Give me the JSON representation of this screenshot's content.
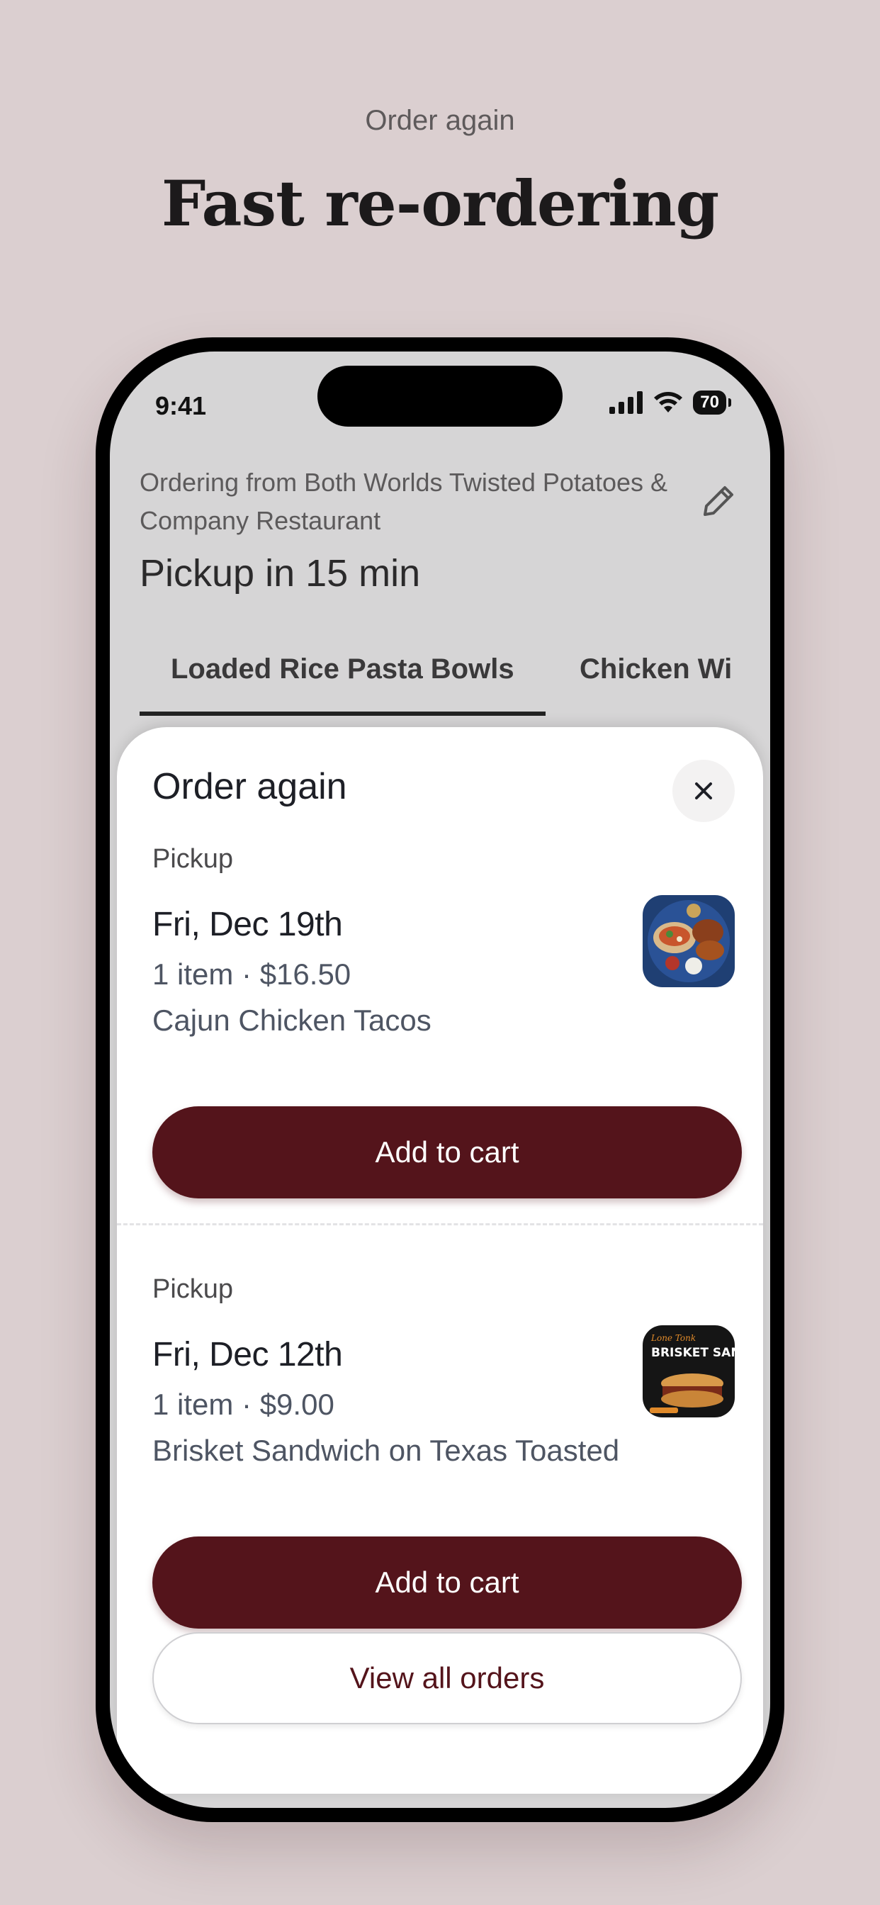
{
  "marketing": {
    "eyebrow": "Order again",
    "headline": "Fast re-ordering"
  },
  "status_bar": {
    "time": "9:41",
    "battery": "70",
    "icons": [
      "cellular-signal-icon",
      "wifi-icon",
      "battery-icon"
    ]
  },
  "header": {
    "ordering_from": "Ordering from Both Worlds Twisted Potatoes & Company Restaurant",
    "pickup_time": "Pickup in 15 min",
    "edit_icon": "pencil-icon"
  },
  "tabs": [
    {
      "label": "Loaded Rice Pasta Bowls",
      "active": true
    },
    {
      "label": "Chicken Wi",
      "active": false
    }
  ],
  "sheet": {
    "title": "Order again",
    "close_icon": "close-icon",
    "orders": [
      {
        "type": "Pickup",
        "date": "Fri, Dec 19th",
        "meta": "1 item · $16.50",
        "item": "Cajun Chicken Tacos",
        "thumbnail": "tacos-photo",
        "button_label": "Add to cart"
      },
      {
        "type": "Pickup",
        "date": "Fri, Dec 12th",
        "meta": "1 item · $9.00",
        "item": "Brisket Sandwich on Texas Toasted",
        "thumbnail": "brisket-sandwich-photo",
        "thumbnail_text": "BRISKET SANDWICH",
        "button_label": "Add to cart"
      }
    ],
    "view_all_label": "View all orders"
  },
  "colors": {
    "background": "#dbcfd0",
    "primary_button": "#54141b",
    "sheet": "#ffffff"
  }
}
